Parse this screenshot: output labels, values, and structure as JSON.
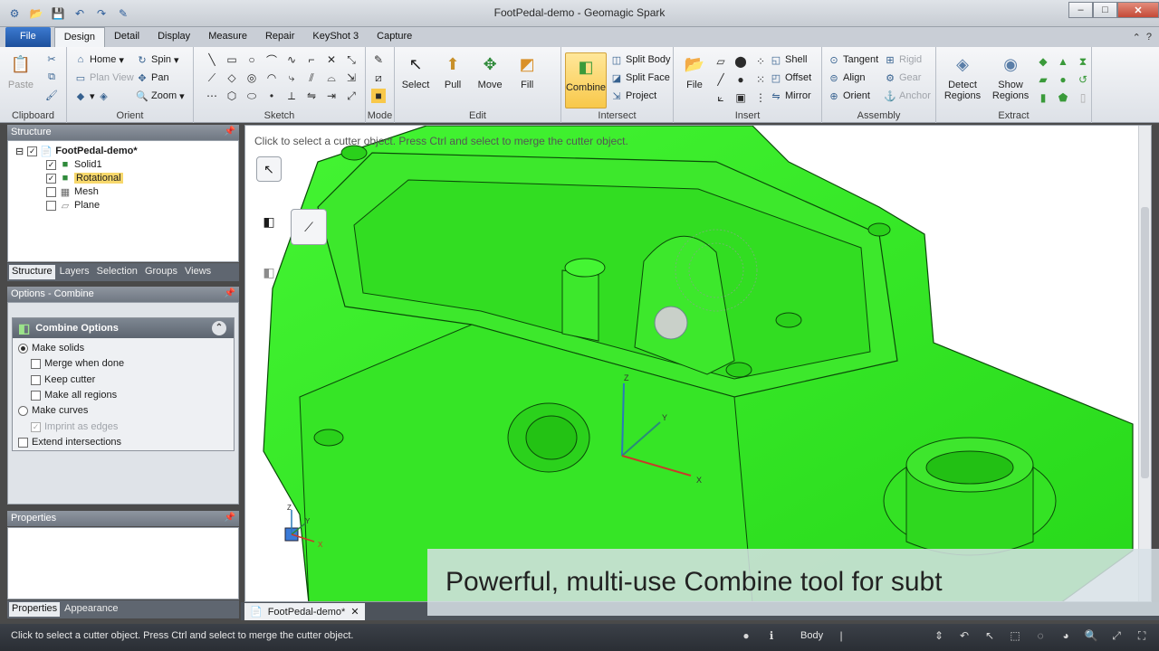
{
  "app": {
    "title": "FootPedal-demo - Geomagic Spark"
  },
  "window": {
    "minimize": "–",
    "maximize": "□",
    "close": "✕"
  },
  "tabs": [
    "File",
    "Design",
    "Detail",
    "Display",
    "Measure",
    "Repair",
    "KeyShot 3",
    "Capture"
  ],
  "active_tab": "Design",
  "ribbon": {
    "clipboard": {
      "label": "Clipboard",
      "paste": "Paste"
    },
    "orient": {
      "label": "Orient",
      "home": "Home",
      "plan_view": "Plan View",
      "spin": "Spin",
      "pan": "Pan",
      "zoom": "Zoom"
    },
    "sketch": {
      "label": "Sketch"
    },
    "mode": {
      "label": "Mode"
    },
    "edit": {
      "label": "Edit",
      "select": "Select",
      "pull": "Pull",
      "move": "Move",
      "fill": "Fill"
    },
    "intersect": {
      "label": "Intersect",
      "combine": "Combine",
      "split_body": "Split Body",
      "split_face": "Split Face",
      "project": "Project"
    },
    "insert": {
      "label": "Insert",
      "file": "File",
      "shell": "Shell",
      "offset": "Offset",
      "mirror": "Mirror"
    },
    "assembly": {
      "label": "Assembly",
      "tangent": "Tangent",
      "align": "Align",
      "orient": "Orient",
      "rigid": "Rigid",
      "gear": "Gear",
      "anchor": "Anchor"
    },
    "extract": {
      "label": "Extract",
      "detect_regions": "Detect Regions",
      "show_regions": "Show Regions"
    }
  },
  "structure": {
    "title": "Structure",
    "root": "FootPedal-demo*",
    "items": [
      {
        "label": "Solid1",
        "checked": true
      },
      {
        "label": "Rotational",
        "checked": true
      },
      {
        "label": "Mesh",
        "checked": false
      },
      {
        "label": "Plane",
        "checked": false
      }
    ],
    "tabs": [
      "Structure",
      "Layers",
      "Selection",
      "Groups",
      "Views"
    ]
  },
  "options": {
    "title": "Options - Combine",
    "box_title": "Combine Options",
    "make_solids": "Make solids",
    "merge_when_done": "Merge when done",
    "keep_cutter": "Keep cutter",
    "make_all_regions": "Make all regions",
    "make_curves": "Make curves",
    "imprint_as_edges": "Imprint as edges",
    "extend_intersections": "Extend intersections"
  },
  "properties": {
    "title": "Properties",
    "tabs": [
      "Properties",
      "Appearance"
    ]
  },
  "viewport": {
    "prompt": "Click to select a cutter object. Press Ctrl and select to merge the cutter object.",
    "axis_x": "X",
    "axis_y": "Y",
    "axis_z": "Z",
    "model_color": "#33ee22"
  },
  "doc_tab": {
    "label": "FootPedal-demo*",
    "close": "✕"
  },
  "caption": "Powerful, multi-use Combine tool for subt",
  "status": {
    "text": "Click to select a cutter object. Press Ctrl and select to merge the cutter object.",
    "mode": "Body"
  },
  "help": {
    "question": "?",
    "expand": "⌃"
  }
}
